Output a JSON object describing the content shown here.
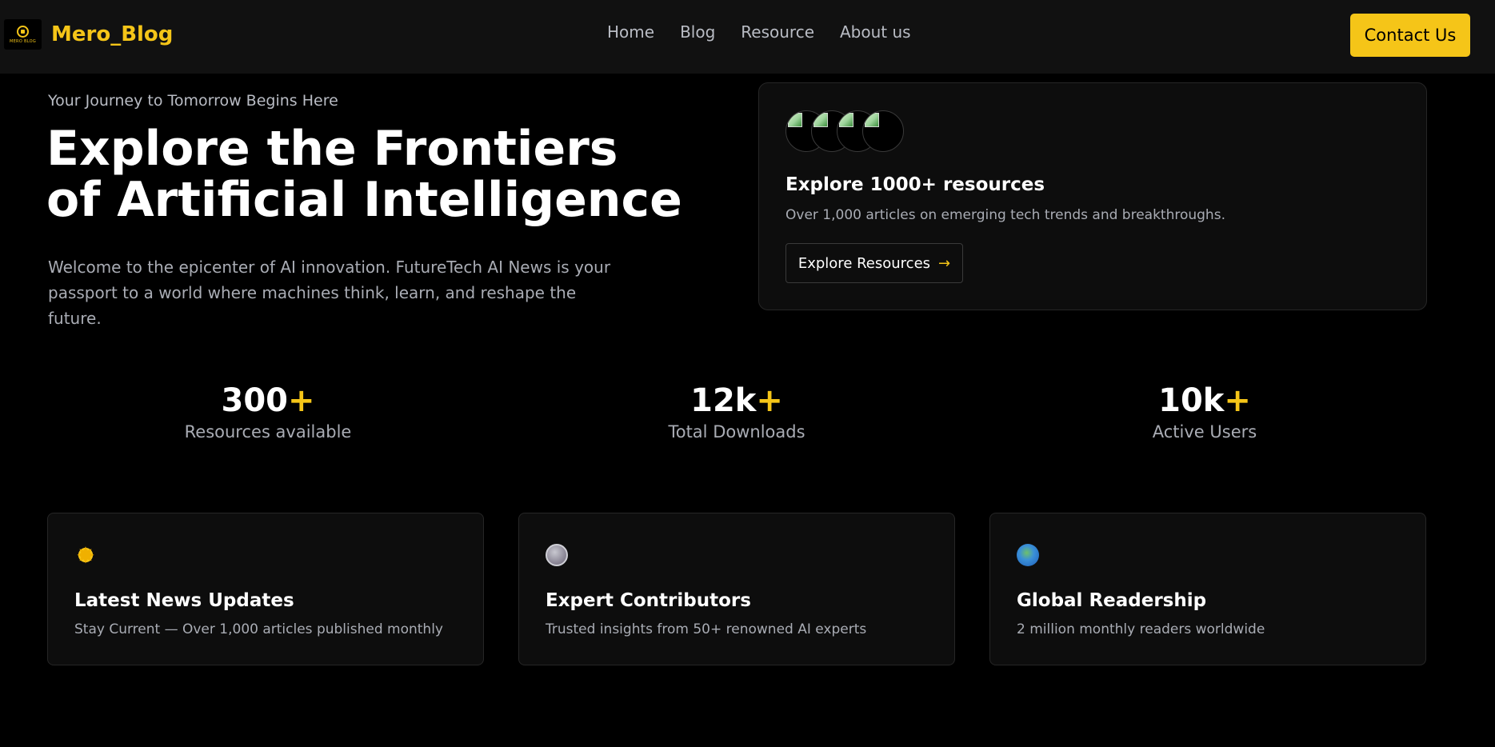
{
  "header": {
    "logo_text": "MERO BLOG",
    "brand": "Mero_Blog",
    "nav": [
      "Home",
      "Blog",
      "Resource",
      "About us"
    ],
    "contact_label": "Contact Us"
  },
  "hero": {
    "tagline": "Your Journey to Tomorrow Begins Here",
    "title": "Explore the Frontiers of Artificial Intelligence",
    "description": "Welcome to the epicenter of AI innovation. FutureTech AI News is your passport to a world where machines think, learn, and reshape the future."
  },
  "resource_card": {
    "title": "Explore 1000+ resources",
    "subtitle": "Over 1,000 articles on emerging tech trends and breakthroughs.",
    "button_label": "Explore Resources",
    "button_arrow": "→",
    "avatar_count": 4
  },
  "stats": [
    {
      "value": "300",
      "plus": "+",
      "label": "Resources available"
    },
    {
      "value": "12k",
      "plus": "+",
      "label": "Total Downloads"
    },
    {
      "value": "10k",
      "plus": "+",
      "label": "Active Users"
    }
  ],
  "features": [
    {
      "icon": "sun-icon",
      "title": "Latest News Updates",
      "description": "Stay Current — Over 1,000 articles published monthly"
    },
    {
      "icon": "circle-icon",
      "title": "Expert Contributors",
      "description": "Trusted insights from 50+ renowned AI experts"
    },
    {
      "icon": "globe-icon",
      "title": "Global Readership",
      "description": "2 million monthly readers worldwide"
    }
  ],
  "colors": {
    "accent": "#f5c518",
    "background": "#000000",
    "surface": "#0d0d0d",
    "muted_text": "#a9acb4"
  }
}
